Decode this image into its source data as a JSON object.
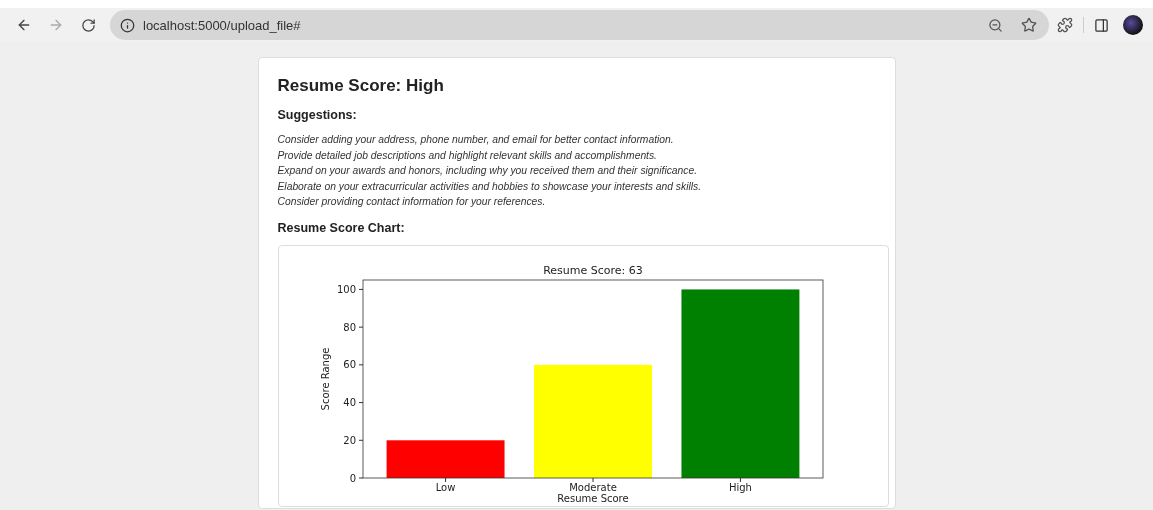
{
  "browser": {
    "url": "localhost:5000/upload_file#"
  },
  "result": {
    "title": "Resume Score: High",
    "suggestions_heading": "Suggestions:",
    "suggestions": [
      "Consider adding your address, phone number, and email for better contact information.",
      "Provide detailed job descriptions and highlight relevant skills and accomplishments.",
      "Expand on your awards and honors, including why you received them and their significance.",
      "Elaborate on your extracurricular activities and hobbies to showcase your interests and skills.",
      "Consider providing contact information for your references."
    ],
    "chart_heading": "Resume Score Chart:",
    "chart_data": {
      "type": "bar",
      "title": "Resume Score: 63",
      "xlabel": "Resume Score",
      "ylabel": "Score Range",
      "categories": [
        "Low",
        "Moderate",
        "High"
      ],
      "series": [
        {
          "colors": [
            "#ff0000",
            "#ffff00",
            "#008000"
          ],
          "values": [
            20,
            60,
            100
          ]
        }
      ],
      "ylim": [
        0,
        105
      ],
      "yticks": [
        0,
        20,
        40,
        60,
        80,
        100
      ]
    }
  }
}
